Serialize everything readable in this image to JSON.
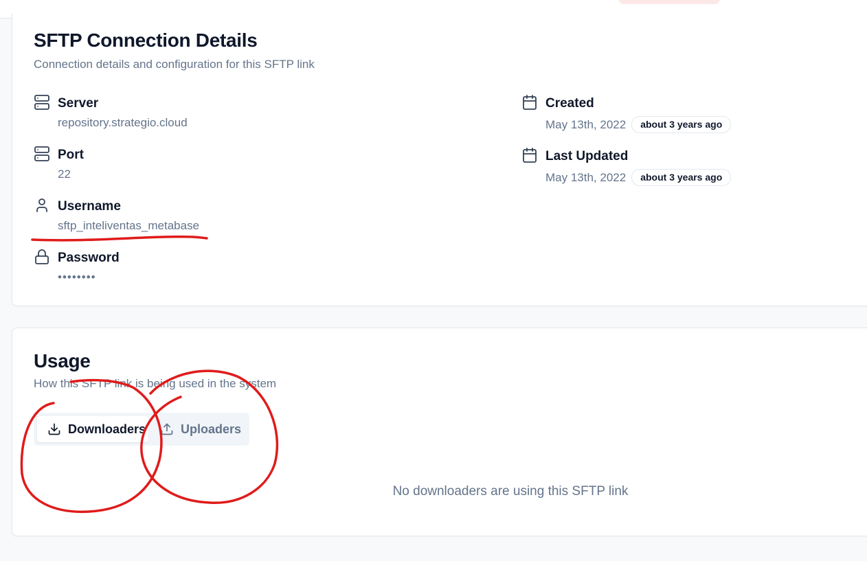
{
  "details": {
    "title": "SFTP Connection Details",
    "subtitle": "Connection details and configuration for this SFTP link",
    "server": {
      "label": "Server",
      "value": "repository.strategio.cloud",
      "icon": "server-icon"
    },
    "port": {
      "label": "Port",
      "value": "22",
      "icon": "server-icon"
    },
    "username": {
      "label": "Username",
      "value": "sftp_inteliventas_metabase",
      "icon": "user-icon"
    },
    "password": {
      "label": "Password",
      "value": "••••••••",
      "icon": "lock-icon"
    },
    "created": {
      "label": "Created",
      "value": "May 13th, 2022",
      "relative": "about 3 years ago",
      "icon": "calendar-icon"
    },
    "updated": {
      "label": "Last Updated",
      "value": "May 13th, 2022",
      "relative": "about 3 years ago",
      "icon": "calendar-icon"
    }
  },
  "usage": {
    "title": "Usage",
    "subtitle": "How this SFTP link is being used in the system",
    "tabs": [
      {
        "label": "Downloaders",
        "icon": "download-icon",
        "active": true
      },
      {
        "label": "Uploaders",
        "icon": "upload-icon",
        "active": false
      }
    ],
    "empty_message": "No downloaders are using this SFTP link"
  },
  "colors": {
    "annotation": "#e01b1b",
    "muted_text": "#64748b",
    "heading_text": "#0f172a",
    "page_bg": "#f8f9fb"
  }
}
